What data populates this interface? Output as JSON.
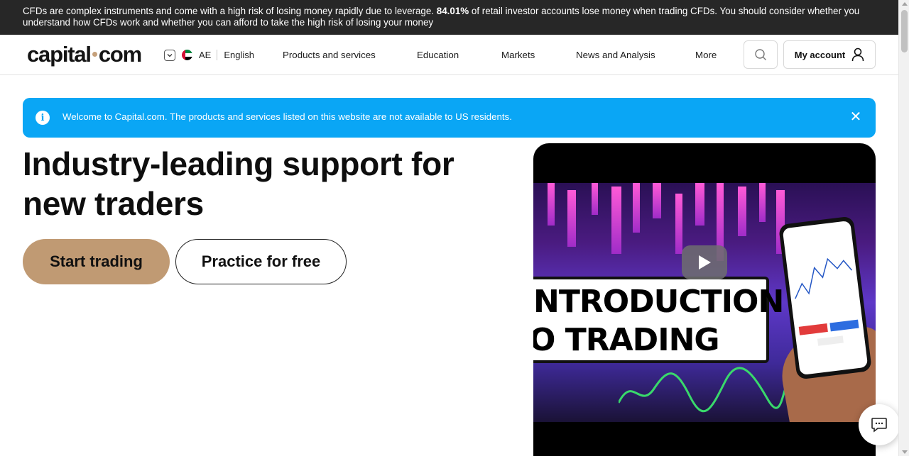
{
  "risk_banner": {
    "text_before": "CFDs are complex instruments and come with a high risk of losing money rapidly due to leverage. ",
    "percent": "84.01%",
    "text_after": " of retail investor accounts lose money when trading CFDs. You should consider whether you understand how CFDs work and whether you can afford to take the high risk of losing your money"
  },
  "header": {
    "logo_left": "capital",
    "logo_right": "com",
    "region_code": "AE",
    "language": "English",
    "nav": [
      {
        "label": "Products and services"
      },
      {
        "label": "Education"
      },
      {
        "label": "Markets"
      },
      {
        "label": "News and Analysis"
      },
      {
        "label": "More"
      }
    ],
    "account_label": "My account"
  },
  "alert": {
    "message": "Welcome to Capital.com. The products and services listed on this website are not available to US residents.",
    "close_glyph": "✕"
  },
  "hero": {
    "title": "Industry-leading support for new traders",
    "start_button": "Start trading",
    "practice_button": "Practice for free"
  },
  "video": {
    "line1": "NTRODUCTION",
    "line2": "O TRADING"
  },
  "colors": {
    "accent": "#c09a73",
    "alert_blue": "#0aa6f5",
    "banner_dark": "#272727"
  },
  "icons": {
    "search": "search-icon",
    "account": "user-icon",
    "info": "info-icon",
    "close": "close-icon",
    "play": "play-icon",
    "chat": "chat-icon"
  }
}
